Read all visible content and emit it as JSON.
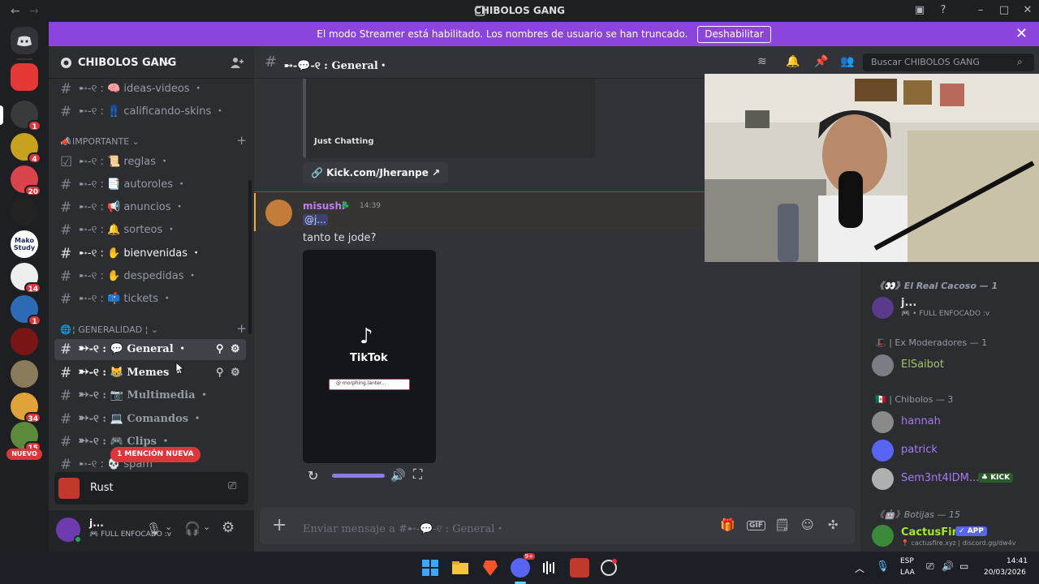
{
  "window": {
    "title": "CHIBOLOS GANG",
    "back": "←",
    "forward": "→"
  },
  "servers": {
    "badges": [
      "1",
      "4",
      "20",
      "14",
      "1",
      "34",
      "15"
    ],
    "new_label": "NUEVO",
    "mako_label": "Mako Study"
  },
  "banner": {
    "text": "El modo Streamer está habilitado. Los nombres de usuario se han truncado.",
    "button": "Deshabilitar"
  },
  "guild": {
    "name": "CHIBOLOS GANG"
  },
  "channels": {
    "top": [
      {
        "label": "ideas-videos",
        "emoji": "🧠"
      },
      {
        "label": "calificando-skins",
        "emoji": "👖"
      }
    ],
    "cat_important": "IMPORTANTE",
    "important": [
      {
        "label": "reglas",
        "emoji": "📜"
      },
      {
        "label": "autoroles",
        "emoji": "📑"
      },
      {
        "label": "anuncios",
        "emoji": "📢"
      },
      {
        "label": "sorteos",
        "emoji": "🔔"
      },
      {
        "label": "bienvenidas",
        "emoji": "✋"
      },
      {
        "label": "despedidas",
        "emoji": "✋"
      },
      {
        "label": "tickets",
        "emoji": "📫"
      }
    ],
    "cat_general": "GENERALIDAD",
    "general": [
      {
        "label": "General",
        "emoji": "💬"
      },
      {
        "label": "Memes",
        "emoji": "😹"
      },
      {
        "label": "Multimedia",
        "emoji": "📷"
      },
      {
        "label": "Comandos",
        "emoji": "💻"
      },
      {
        "label": "Clips",
        "emoji": "🎮"
      },
      {
        "label": "spam",
        "emoji": "💀"
      }
    ],
    "prefix": "➸-୧ :",
    "mention": "1 MENCIÓN NUEVA"
  },
  "activity": {
    "label": "Rust"
  },
  "user": {
    "name": "j...",
    "status": "FULL ENFOCADO :v"
  },
  "chat": {
    "channel_title": "➸-💬-୧ : General・",
    "search_placeholder": "Buscar CHIBOLOS GANG",
    "embed_category": "Just Chatting",
    "link_button": "Kick.com/Jheranpe",
    "message": {
      "author": "misushi",
      "time": "14:39",
      "mention": "@j...",
      "text": "tanto te jode?"
    },
    "tiktok_label": "TikTok",
    "tiktok_search": "@ morphing.lanter...",
    "composer_placeholder": "Enviar mensaje a #➸-💬-୧ : General・"
  },
  "members": {
    "groups": [
      {
        "name": "《👀》El Real Cacoso — 1"
      },
      {
        "name": "🎩 | Ex Moderadores — 1"
      },
      {
        "name": "🇲🇽 | Chibolos — 3"
      },
      {
        "name": "《🤖》Botijas — 15"
      }
    ],
    "items": [
      {
        "name": "j...",
        "sub": "FULL ENFOCADO :v",
        "color": "#dbdee1"
      },
      {
        "name": "ElSaibot",
        "color": "#a3c46c"
      },
      {
        "name": "hannah",
        "color": "#a779f7"
      },
      {
        "name": "patrick",
        "color": "#a779f7"
      },
      {
        "name": "Sem3nt4IDM...",
        "color": "#a779f7",
        "tag": "KICK"
      },
      {
        "name": "CactusFire",
        "color": "#a3e635",
        "tag": "APP",
        "sub": "cactusfire.xyz | discord.gg/dw4v"
      }
    ]
  },
  "taskbar": {
    "lang": "ESP",
    "lang2": "LAA",
    "time": "14:41",
    "date": "20/03/2026",
    "discord_badge": "9+"
  }
}
